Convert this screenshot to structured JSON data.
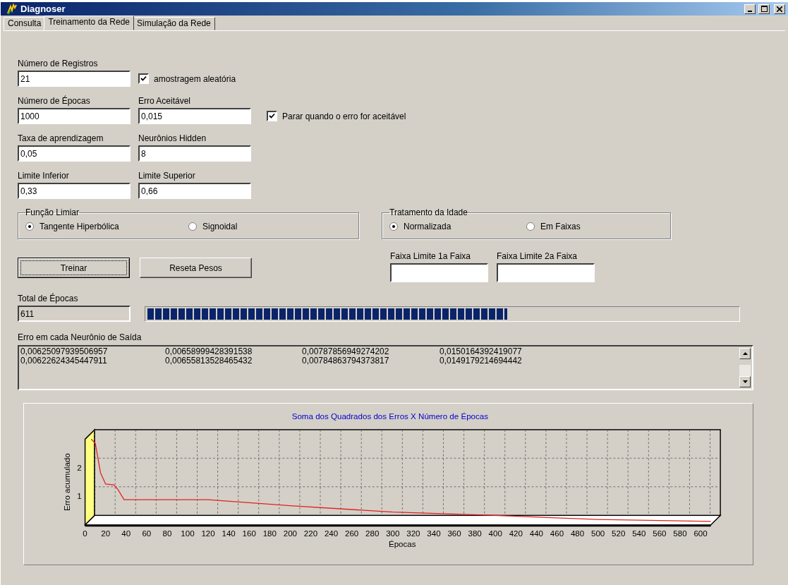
{
  "window": {
    "title": "Diagnoser"
  },
  "tabs": [
    {
      "label": "Consulta",
      "selected": false
    },
    {
      "label": "Treinamento da Rede",
      "selected": true
    },
    {
      "label": "Simulação da Rede",
      "selected": false
    }
  ],
  "rows": [
    {
      "items": [
        {
          "kind": "field",
          "label": "Número de Registros",
          "value": "21"
        },
        {
          "kind": "checkbox",
          "label": "amostragem aleatória",
          "checked": true
        }
      ]
    },
    {
      "items": [
        {
          "kind": "field",
          "label": "Número de Épocas",
          "value": "1000"
        },
        {
          "kind": "field",
          "label": "Erro Aceitável",
          "value": "0,015"
        },
        {
          "kind": "checkbox",
          "label": "Parar quando o erro for aceitável",
          "checked": true
        }
      ]
    },
    {
      "items": [
        {
          "kind": "field",
          "label": "Taxa de aprendizagem",
          "value": "0,05"
        },
        {
          "kind": "field",
          "label": "Neurônios Hidden",
          "value": "8"
        }
      ]
    },
    {
      "items": [
        {
          "kind": "field",
          "label": "Limite Inferior",
          "value": "0,33"
        },
        {
          "kind": "field",
          "label": "Limite Superior",
          "value": "0,66"
        }
      ]
    }
  ],
  "groups": [
    {
      "title": "Função Limiar",
      "options": [
        {
          "label": "Tangente Hiperbólica",
          "selected": true
        },
        {
          "label": "Signoidal",
          "selected": false
        }
      ]
    },
    {
      "title": "Tratamento da Idade",
      "options": [
        {
          "label": "Normalizada",
          "selected": true
        },
        {
          "label": "Em Faixas",
          "selected": false
        }
      ]
    }
  ],
  "buttons": [
    {
      "label": "Treinar",
      "focused": true
    },
    {
      "label": "Reseta Pesos",
      "focused": false
    }
  ],
  "range_fields": [
    {
      "label": "Faixa Limite 1a Faixa"
    },
    {
      "label": "Faixa Limite 2a Faixa"
    }
  ],
  "total": {
    "label": "Total de Épocas",
    "value": "611"
  },
  "progress": {
    "level": 0.61
  },
  "errors": {
    "label": "Erro em cada Neurônio de Saída",
    "rows": [
      [
        "0,00625097939506957",
        "0,00658999428391538",
        "0,00787856949274202",
        "0,0150164392419077"
      ],
      [
        "0,00622624345447911",
        "0,00655813528465432",
        "0,00784863794373817",
        "0,0149179214694442"
      ]
    ]
  },
  "chart": {
    "chart_data": {
      "type": "line",
      "title": "Soma dos Quadrados dos Erros X Número de Épocas",
      "xlabel": "Épocas",
      "ylabel": "Erro acumulado",
      "x": [
        6,
        10,
        15,
        20,
        28,
        32,
        38,
        120,
        200,
        300,
        400,
        500,
        610
      ],
      "series": [
        {
          "color": "#e02020",
          "values": [
            3.0,
            2.85,
            1.83,
            1.43,
            1.4,
            1.24,
            0.88,
            0.88,
            0.67,
            0.45,
            0.33,
            0.19,
            0.12
          ]
        }
      ],
      "xlim": [
        0,
        610
      ],
      "ylim": [
        0,
        3.33
      ],
      "xticks": [
        0,
        20,
        40,
        60,
        80,
        100,
        120,
        140,
        160,
        180,
        200,
        220,
        240,
        260,
        280,
        300,
        320,
        340,
        360,
        380,
        400,
        420,
        440,
        460,
        480,
        500,
        520,
        540,
        560,
        580,
        600
      ],
      "yticks": [
        1,
        2
      ]
    }
  }
}
